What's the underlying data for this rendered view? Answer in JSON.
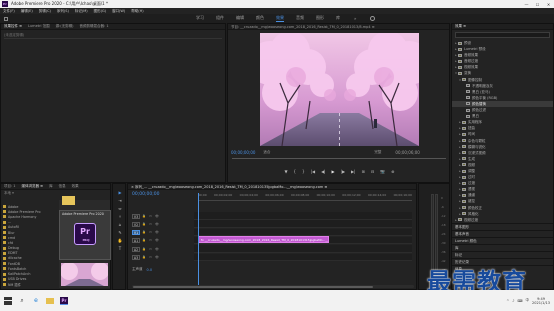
{
  "window": {
    "title": "Adobe Premiere Pro 2020 - C:\\用户\\Ichao\\桌面\\1 *",
    "min": "—",
    "max": "☐",
    "close": "✕"
  },
  "menu": [
    "文件(F)",
    "编辑(E)",
    "剪辑(C)",
    "序列(S)",
    "标记(M)",
    "图形(G)",
    "窗口(W)",
    "帮助(H)"
  ],
  "workspaces": {
    "tabs": [
      "学习",
      "组件",
      "编辑",
      "颜色",
      "效果",
      "音频",
      "图形",
      "库"
    ],
    "active_index": 4,
    "more": "»"
  },
  "source_panel": {
    "tabs": [
      "效果控件 ≡",
      "Lumetri 范围",
      "源:(无剪辑)",
      "音频剪辑混合器: 1"
    ],
    "sequence_label": "序列 01 * 剪辑 * 主要 * 2018_..._mp4",
    "no_clip": "(未选定剪辑)"
  },
  "program_panel": {
    "title": "节目: __cruzado__mg/wooseong.com_2018_2016_Resist_TM_0_20181013/8.mp4 ≡",
    "timecode": "00;00;00;00",
    "fit": "适合",
    "full": "完整",
    "duration": "00;00;06;00",
    "transport": [
      "▼",
      "{",
      "}",
      "|◀",
      "◀|",
      "▶",
      "|▶",
      "▶|",
      "⊞",
      "⊟",
      "📷",
      "⊕"
    ]
  },
  "effects_panel": {
    "tab": "效果 ≡",
    "items": [
      {
        "label": "预设",
        "indent": 0,
        "type": "folder"
      },
      {
        "label": "Lumetri 预设",
        "indent": 0,
        "type": "folder"
      },
      {
        "label": "音频效果",
        "indent": 0,
        "type": "folder"
      },
      {
        "label": "音频过渡",
        "indent": 0,
        "type": "folder"
      },
      {
        "label": "视频效果",
        "indent": 0,
        "type": "folder"
      },
      {
        "label": "变换",
        "indent": 0,
        "type": "folder",
        "open": true
      },
      {
        "label": "图像控制",
        "indent": 1,
        "type": "folder",
        "open": true
      },
      {
        "label": "不透明度及灰",
        "indent": 2,
        "type": "fx"
      },
      {
        "label": "黑白 (亚马)",
        "indent": 2,
        "type": "fx"
      },
      {
        "label": "颜色平衡 (RGB)",
        "indent": 2,
        "type": "fx"
      },
      {
        "label": "颜色替换",
        "indent": 2,
        "type": "fx",
        "selected": true
      },
      {
        "label": "颜色过滤",
        "indent": 2,
        "type": "fx"
      },
      {
        "label": "黑白",
        "indent": 2,
        "type": "fx"
      },
      {
        "label": "实用程序",
        "indent": 1,
        "type": "folder"
      },
      {
        "label": "扭曲",
        "indent": 1,
        "type": "folder"
      },
      {
        "label": "时间",
        "indent": 1,
        "type": "folder"
      },
      {
        "label": "杂色与颗粒",
        "indent": 1,
        "type": "folder"
      },
      {
        "label": "模糊与锐化",
        "indent": 1,
        "type": "folder"
      },
      {
        "label": "沉浸式视频",
        "indent": 1,
        "type": "folder"
      },
      {
        "label": "生成",
        "indent": 1,
        "type": "folder"
      },
      {
        "label": "视频",
        "indent": 1,
        "type": "folder"
      },
      {
        "label": "调整",
        "indent": 1,
        "type": "folder"
      },
      {
        "label": "过时",
        "indent": 1,
        "type": "folder"
      },
      {
        "label": "过渡",
        "indent": 1,
        "type": "folder"
      },
      {
        "label": "透视",
        "indent": 1,
        "type": "folder"
      },
      {
        "label": "通道",
        "indent": 1,
        "type": "folder"
      },
      {
        "label": "键控",
        "indent": 1,
        "type": "folder"
      },
      {
        "label": "颜色校正",
        "indent": 1,
        "type": "folder"
      },
      {
        "label": "风格化",
        "indent": 1,
        "type": "folder"
      },
      {
        "label": "视频过渡",
        "indent": 0,
        "type": "folder"
      }
    ],
    "sections": [
      "基本图形",
      "基本声音",
      "Lumetri 颜色",
      "库",
      "标记",
      "历史记录",
      "信息"
    ]
  },
  "project_panel": {
    "tabs": [
      "项目: 1",
      "媒体浏览器 ≡",
      "库",
      "信息",
      "效果"
    ],
    "path": "本地 ▾",
    "items": [
      "Adobe",
      "Adobe Premiere Pro",
      "Apache Harmony",
      "...",
      "AutoRI",
      "Blur",
      "cmd",
      "cfd",
      "Debug",
      "EDMT",
      "dllcache",
      "FontDB",
      "FontsBatch",
      "KaliPatchArch",
      "USB Drives",
      "NM 插件"
    ],
    "tooltip": "Adobe Premiere Pro 2020",
    "pr_logo": "Pr",
    "pr_caption": "PROJ",
    "clip_label": "14:00"
  },
  "tools": [
    "▶",
    "⇥",
    "⇔",
    "⟊",
    "⌂",
    "✎",
    "✋",
    "T"
  ],
  "timeline": {
    "tab": "× 序列_... __cruzado__mg/wooseong.com_2018_2016_Resist_TM_0_201810135jpgbaMo...__mg/wooseong.com ≡",
    "timecode": "00;00;00;00",
    "ruler": [
      "00;00",
      "00;00;02;00",
      "00;00;04;00",
      "00;00;06;00",
      "00;00;08;00",
      "00;00;10;00",
      "00;00;12;00",
      "00;00;14;00",
      "00;00;16;00"
    ],
    "tracks": [
      {
        "name": "V3",
        "blue": false
      },
      {
        "name": "V2",
        "blue": false
      },
      {
        "name": "V1",
        "blue": true
      },
      {
        "name": "A1",
        "blue": false
      },
      {
        "name": "A2",
        "blue": false
      },
      {
        "name": "A3",
        "blue": false
      }
    ],
    "track_icons": [
      "🔒",
      "▭",
      "👁"
    ],
    "clip": "fx  __cruzado__mg/wooseong.com_2018_2016_Resist_TM_0_2018101315jpgbaMo...__mg",
    "master_label": "主声道",
    "master_value": "0.0"
  },
  "meter": {
    "scale": [
      "0",
      "-6",
      "-12",
      "-18",
      "-24",
      "-30",
      "-36",
      "-42",
      "-48",
      "-54"
    ]
  },
  "watermark": "最需教育",
  "taskbar": {
    "search": "⌕",
    "edge": "e",
    "pr": "Pr",
    "tray": [
      "^",
      "♪",
      "⌨",
      "中"
    ],
    "time": "9:49",
    "date": "2021/1/13"
  }
}
